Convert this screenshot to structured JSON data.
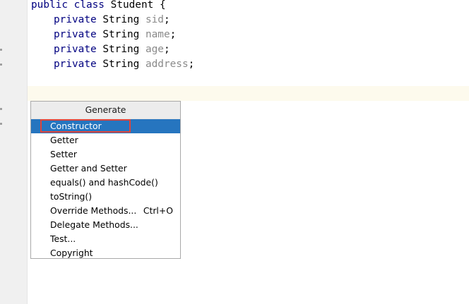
{
  "code": {
    "line1": {
      "kw1": "public",
      "kw2": "class",
      "name": "Student",
      "brace": "{"
    },
    "fields": [
      {
        "modifier": "private",
        "type": "String",
        "name": "sid",
        "semi": ";"
      },
      {
        "modifier": "private",
        "type": "String",
        "name": "name",
        "semi": ";"
      },
      {
        "modifier": "private",
        "type": "String",
        "name": "age",
        "semi": ";"
      },
      {
        "modifier": "private",
        "type": "String",
        "name": "address",
        "semi": ";"
      }
    ]
  },
  "popup": {
    "title": "Generate",
    "items": [
      {
        "label": "Constructor",
        "shortcut": ""
      },
      {
        "label": "Getter",
        "shortcut": ""
      },
      {
        "label": "Setter",
        "shortcut": ""
      },
      {
        "label": "Getter and Setter",
        "shortcut": ""
      },
      {
        "label": "equals() and hashCode()",
        "shortcut": ""
      },
      {
        "label": "toString()",
        "shortcut": ""
      },
      {
        "label": "Override Methods...",
        "shortcut": "Ctrl+O"
      },
      {
        "label": "Delegate Methods...",
        "shortcut": ""
      },
      {
        "label": "Test...",
        "shortcut": ""
      },
      {
        "label": "Copyright",
        "shortcut": ""
      }
    ],
    "selected_index": 0
  },
  "colors": {
    "selection": "#2675bf",
    "annotation_box": "#e0443a",
    "keyword": "#000080",
    "field": "#8a8a8a"
  }
}
